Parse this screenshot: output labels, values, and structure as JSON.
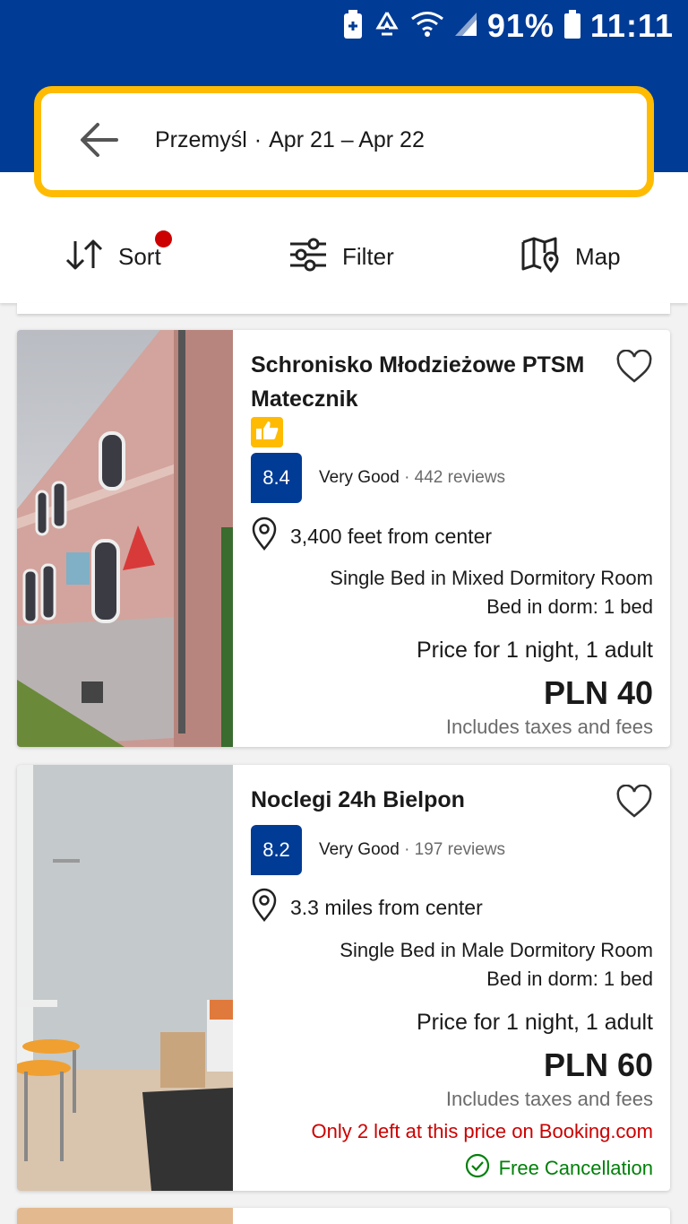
{
  "status_bar": {
    "battery_percent": "91%",
    "time": "11:11",
    "icons": [
      "battery-saver-icon",
      "recycle-icon",
      "wifi-icon",
      "cell-signal-icon",
      "battery-icon"
    ]
  },
  "search": {
    "location": "Przemyśl",
    "separator": "·",
    "dates": "Apr 21 – Apr 22",
    "back_icon": "arrow-left-icon"
  },
  "toolbar": {
    "sort_label": "Sort",
    "filter_label": "Filter",
    "map_label": "Map",
    "sort_has_indicator": true
  },
  "colors": {
    "brand_blue": "#003b95",
    "accent_yellow": "#febb02",
    "alert_red": "#cc0000",
    "success_green": "#008009"
  },
  "listings": [
    {
      "name": "Schronisko Młodzieżowe PTSM Matecznik",
      "has_thumb_badge": true,
      "score": "8.4",
      "score_word": "Very Good",
      "reviews": "· 442 reviews",
      "distance": "3,400 feet from center",
      "room": "Single Bed in Mixed Dormitory Room",
      "bed": "Bed in dorm: 1 bed",
      "price_for": "Price for 1 night, 1 adult",
      "price": "PLN 40",
      "taxes": "Includes taxes and fees"
    },
    {
      "name": "Noclegi 24h Bielpon",
      "has_thumb_badge": false,
      "score": "8.2",
      "score_word": "Very Good",
      "reviews": "· 197 reviews",
      "distance": "3.3 miles from center",
      "room": "Single Bed in Male Dormitory Room",
      "bed": "Bed in dorm: 1 bed",
      "price_for": "Price for 1 night, 1 adult",
      "price": "PLN 60",
      "taxes": "Includes taxes and fees",
      "scarcity": "Only 2 left at this price on Booking.com",
      "free_cancellation": "Free Cancellation"
    }
  ]
}
